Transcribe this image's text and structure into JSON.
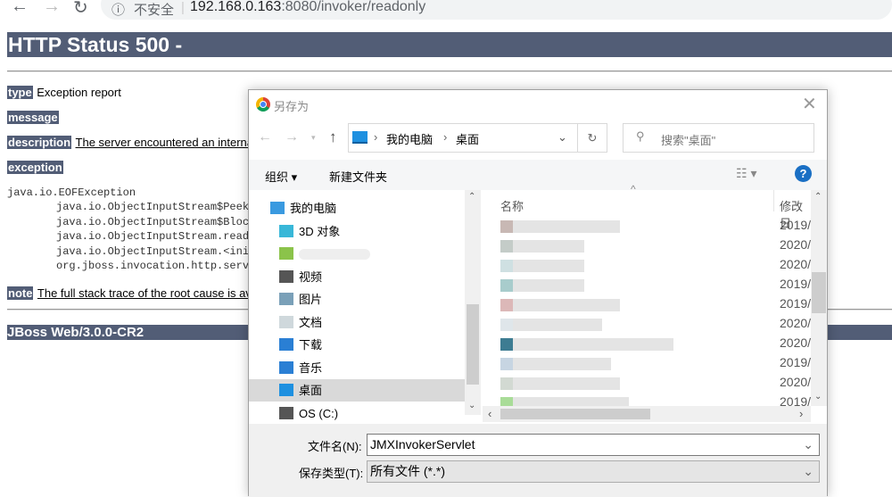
{
  "browser": {
    "insecure_label": "不安全",
    "url_host": "192.168.0.163",
    "url_rest": ":8080/invoker/readonly"
  },
  "page": {
    "title": "HTTP Status 500 -",
    "type_label": "type",
    "type_value": "Exception report",
    "message_label": "message",
    "description_label": "description",
    "description_value": "The server encountered an interna",
    "exception_label": "exception",
    "stack": [
      "java.io.EOFException",
      "\tjava.io.ObjectInputStream$PeekI",
      "\tjava.io.ObjectInputStream$Block",
      "\tjava.io.ObjectInputStream.readS",
      "\tjava.io.ObjectInputStream.<init",
      "\torg.jboss.invocation.http.servl"
    ],
    "note_label": "note",
    "note_value": "The full stack trace of the root cause is av",
    "footer": "JBoss Web/3.0.0-CR2"
  },
  "dialog": {
    "title": "另存为",
    "breadcrumb": [
      "我的电脑",
      "桌面"
    ],
    "search_placeholder": "搜索\"桌面\"",
    "organize": "组织 ▾",
    "new_folder": "新建文件夹",
    "nav": [
      {
        "label": "我的电脑",
        "icon": "computer"
      },
      {
        "label": "3D 对象",
        "icon": "3d-objects"
      },
      {
        "label": "",
        "icon": "network"
      },
      {
        "label": "视频",
        "icon": "video"
      },
      {
        "label": "图片",
        "icon": "pictures"
      },
      {
        "label": "文档",
        "icon": "documents"
      },
      {
        "label": "下载",
        "icon": "download"
      },
      {
        "label": "音乐",
        "icon": "music"
      },
      {
        "label": "桌面",
        "icon": "desktop",
        "selected": true
      },
      {
        "label": "OS (C:)",
        "icon": "drive"
      }
    ],
    "columns": {
      "name": "名称",
      "modified": "修改日"
    },
    "dates": [
      "2019/",
      "2020/",
      "2020/",
      "2019/",
      "2019/",
      "2020/",
      "2020/",
      "2019/",
      "2020/",
      "2019/"
    ],
    "filename_label": "文件名(N):",
    "filename_value": "JMXInvokerServlet",
    "filetype_label": "保存类型(T):",
    "filetype_value": "所有文件 (*.*)"
  }
}
